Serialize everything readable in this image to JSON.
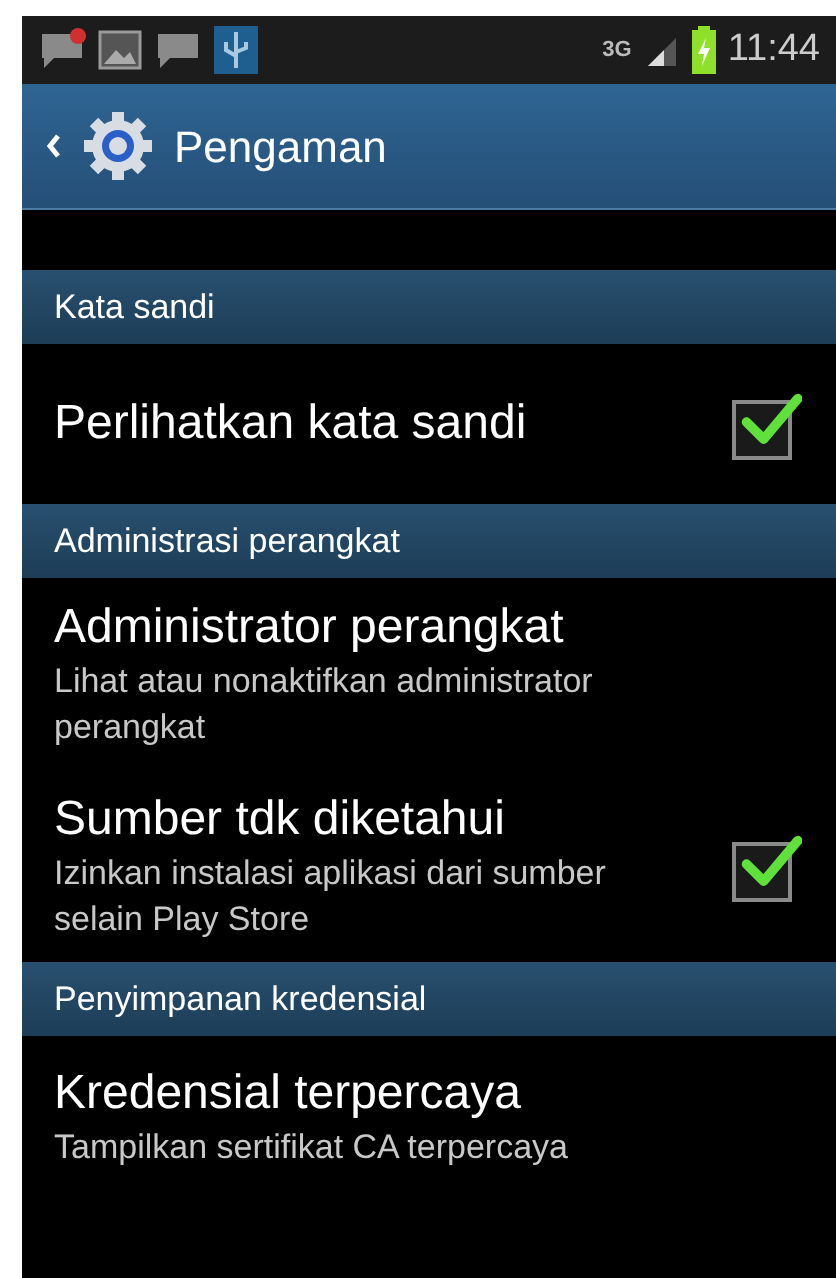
{
  "status_bar": {
    "network": "3G",
    "time": "11:44"
  },
  "header": {
    "title": "Pengaman"
  },
  "sections": [
    {
      "title": "Kata sandi",
      "items": [
        {
          "title": "Perlihatkan kata sandi",
          "kind": "checkbox",
          "checked": true
        }
      ]
    },
    {
      "title": "Administrasi perangkat",
      "items": [
        {
          "title": "Administrator perangkat",
          "summary": "Lihat atau nonaktifkan administrator perangkat",
          "kind": "plain"
        },
        {
          "title": "Sumber tdk diketahui",
          "summary": "Izinkan instalasi aplikasi dari sumber selain Play Store",
          "kind": "checkbox",
          "checked": true
        }
      ]
    },
    {
      "title": "Penyimpanan kredensial",
      "items": [
        {
          "title": "Kredensial terpercaya",
          "summary": "Tampilkan sertifikat CA terpercaya",
          "kind": "plain"
        }
      ]
    }
  ]
}
